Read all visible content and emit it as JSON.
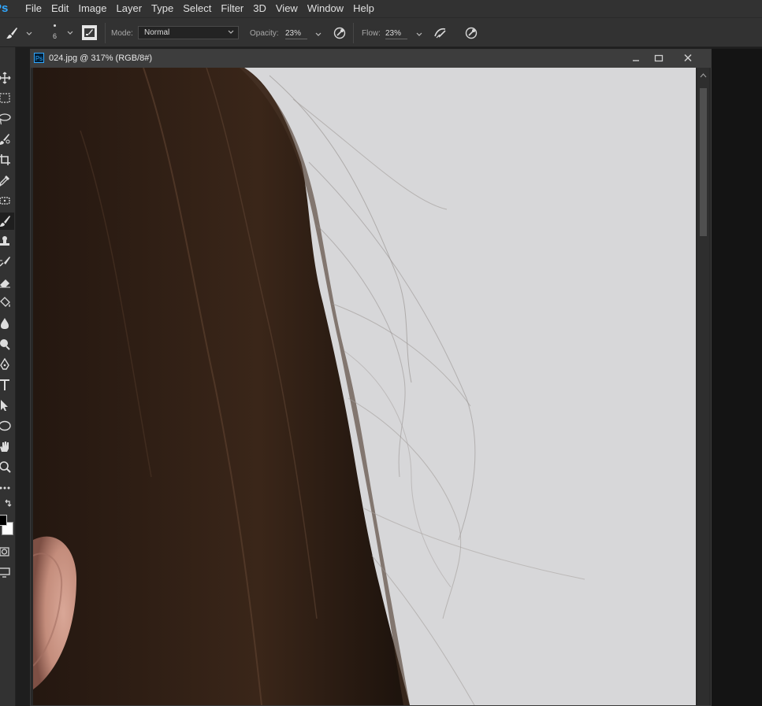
{
  "app": {
    "logo": "Ps"
  },
  "menu": [
    "File",
    "Edit",
    "Image",
    "Layer",
    "Type",
    "Select",
    "Filter",
    "3D",
    "View",
    "Window",
    "Help"
  ],
  "options": {
    "brush_size": "6",
    "mode_label": "Mode:",
    "mode_value": "Normal",
    "opacity_label": "Opacity:",
    "opacity_value": "23%",
    "flow_label": "Flow:",
    "flow_value": "23%"
  },
  "document": {
    "badge": "Ps",
    "title": "024.jpg @ 317% (RGB/8#)"
  },
  "colors": {
    "foreground": "#000000",
    "background": "#ffffff",
    "accent": "#31a8ff",
    "hair": "#2a1a12",
    "backdrop": "#d6d6d8"
  }
}
